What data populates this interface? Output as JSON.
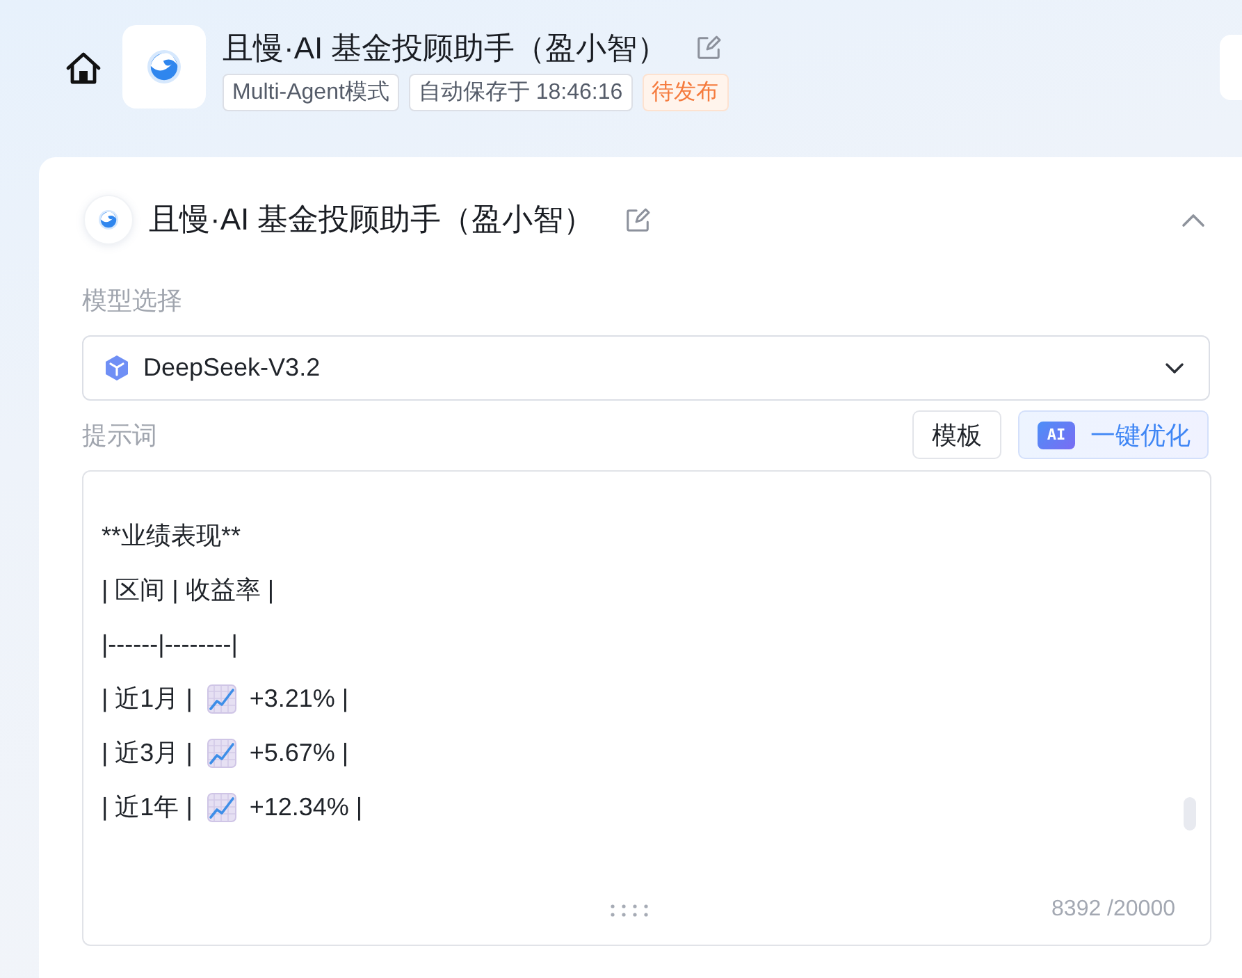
{
  "header": {
    "title": "且慢·AI 基金投顾助手（盈小智）",
    "tags": [
      {
        "text": "Multi-Agent模式",
        "kind": "default"
      },
      {
        "text": "自动保存于 18:46:16",
        "kind": "default"
      },
      {
        "text": "待发布",
        "kind": "warning"
      }
    ]
  },
  "agent_card": {
    "title": "且慢·AI 基金投顾助手（盈小智）",
    "expanded": true,
    "model": {
      "label": "模型选择",
      "value": "DeepSeek-V3.2"
    },
    "prompt": {
      "label": "提示词",
      "buttons": [
        {
          "label": "模板",
          "kind": "plain"
        },
        {
          "label": "一键优化",
          "kind": "ai",
          "badge": "AI"
        }
      ],
      "lines": [
        {
          "kind": "text",
          "text": "**业绩表现**"
        },
        {
          "kind": "text",
          "text": "| 区间 | 收益率 |"
        },
        {
          "kind": "text",
          "text": "|------|--------|"
        },
        {
          "kind": "trend",
          "before": "| 近1月 |",
          "after": "+3.21% |"
        },
        {
          "kind": "trend",
          "before": "| 近3月 |",
          "after": "+5.67% |"
        },
        {
          "kind": "trend",
          "before": "| 近1年 |",
          "after": "+12.34% |"
        }
      ],
      "counter": "8392 /20000"
    }
  }
}
